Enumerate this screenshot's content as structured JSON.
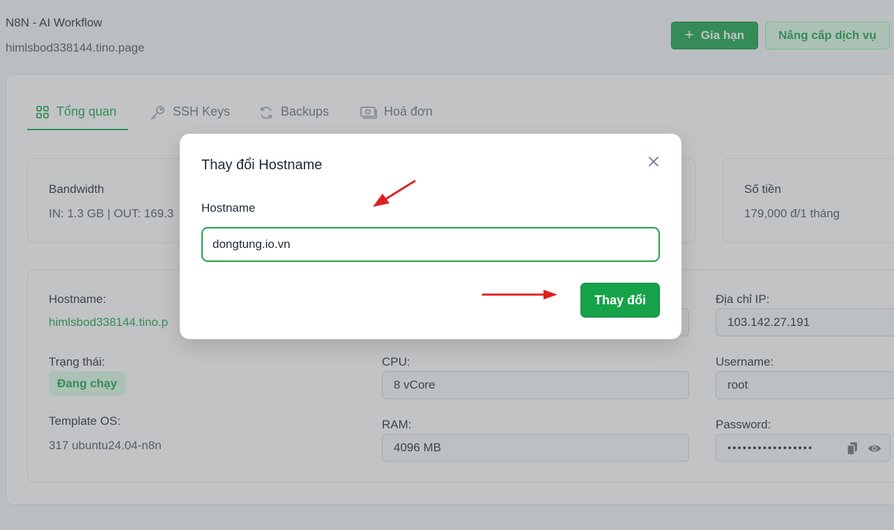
{
  "header": {
    "title": "N8N - AI Workflow",
    "domain": "himlsbod338144.tino.page",
    "renew_label": "Gia hạn",
    "upgrade_label": "Nâng cấp dịch vụ"
  },
  "tabs": [
    {
      "label": "Tổng quan",
      "icon": "grid-icon",
      "active": true
    },
    {
      "label": "SSH Keys",
      "icon": "key-icon",
      "active": false
    },
    {
      "label": "Backups",
      "icon": "refresh-icon",
      "active": false
    },
    {
      "label": "Hoá đơn",
      "icon": "money-icon",
      "active": false
    }
  ],
  "stats": {
    "bandwidth": {
      "label": "Bandwidth",
      "value": "IN: 1.3 GB | OUT: 169.3"
    },
    "price": {
      "label": "Số tiền",
      "value": "179,000 đ/1 tháng"
    }
  },
  "details": {
    "hostname_label": "Hostname:",
    "hostname_value": "himlsbod338144.tino.p",
    "status_label": "Trạng thái:",
    "status_value": "Đang chạy",
    "os_label": "Template OS:",
    "os_value": "317 ubuntu24.04-n8n",
    "cpu_label": "CPU:",
    "cpu_value": "8 vCore",
    "ram_label": "RAM:",
    "ram_value": "4096 MB",
    "ip_label": "Địa chỉ IP:",
    "ip_value": "103.142.27.191",
    "username_label": "Username:",
    "username_value": "root",
    "password_label": "Password:",
    "password_value": "•••••••••••••••••"
  },
  "modal": {
    "title": "Thay đổi Hostname",
    "field_label": "Hostname",
    "field_value": "dongtung.io.vn",
    "submit_label": "Thay đổi"
  },
  "colors": {
    "accent": "#16a34a",
    "annotation_arrow": "#e02020"
  }
}
